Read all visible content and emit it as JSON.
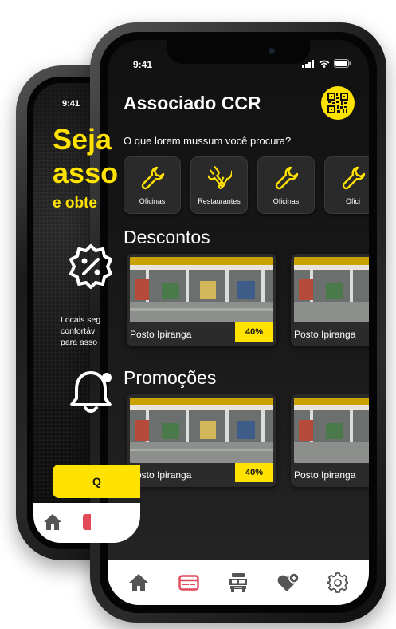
{
  "back_phone": {
    "status_time": "9:41",
    "title_line1": "Seja",
    "title_line2": "asso",
    "subtitle": "e obte",
    "body_text_line1": "Locais seg",
    "body_text_line2": "confortáv",
    "body_text_line3": "para asso",
    "button_label": "Q",
    "badge_icon": "discount-badge-icon",
    "bell_icon": "bell-icon"
  },
  "status": {
    "time": "9:41"
  },
  "header": {
    "title": "Associado CCR",
    "qr_icon": "qr-code-icon"
  },
  "search": {
    "question": "O que lorem mussum você procura?"
  },
  "categories": [
    {
      "label": "Oficinas",
      "icon": "wrench-icon"
    },
    {
      "label": "Restaurantes",
      "icon": "fork-knife-icon"
    },
    {
      "label": "Oficinas",
      "icon": "wrench-icon"
    },
    {
      "label": "Ofici",
      "icon": "wrench-icon"
    }
  ],
  "descontos": {
    "title": "Descontos",
    "cards": [
      {
        "name": "Posto Ipiranga",
        "discount": "40%"
      },
      {
        "name": "Posto Ipiranga",
        "discount": ""
      }
    ]
  },
  "promocoes": {
    "title": "Promoções",
    "cards": [
      {
        "name": "Posto Ipiranga",
        "discount": "40%"
      },
      {
        "name": "Posto Ipiranga",
        "discount": ""
      }
    ]
  },
  "tabbar": [
    {
      "icon": "home-icon",
      "active": false
    },
    {
      "icon": "card-icon",
      "active": true
    },
    {
      "icon": "truck-icon",
      "active": false
    },
    {
      "icon": "heart-plus-icon",
      "active": false
    },
    {
      "icon": "settings-icon",
      "active": false
    }
  ],
  "colors": {
    "accent": "#FFE200",
    "active_tab": "#E24A5A",
    "tab_inactive": "#555555",
    "background": "#1A1A1A"
  }
}
